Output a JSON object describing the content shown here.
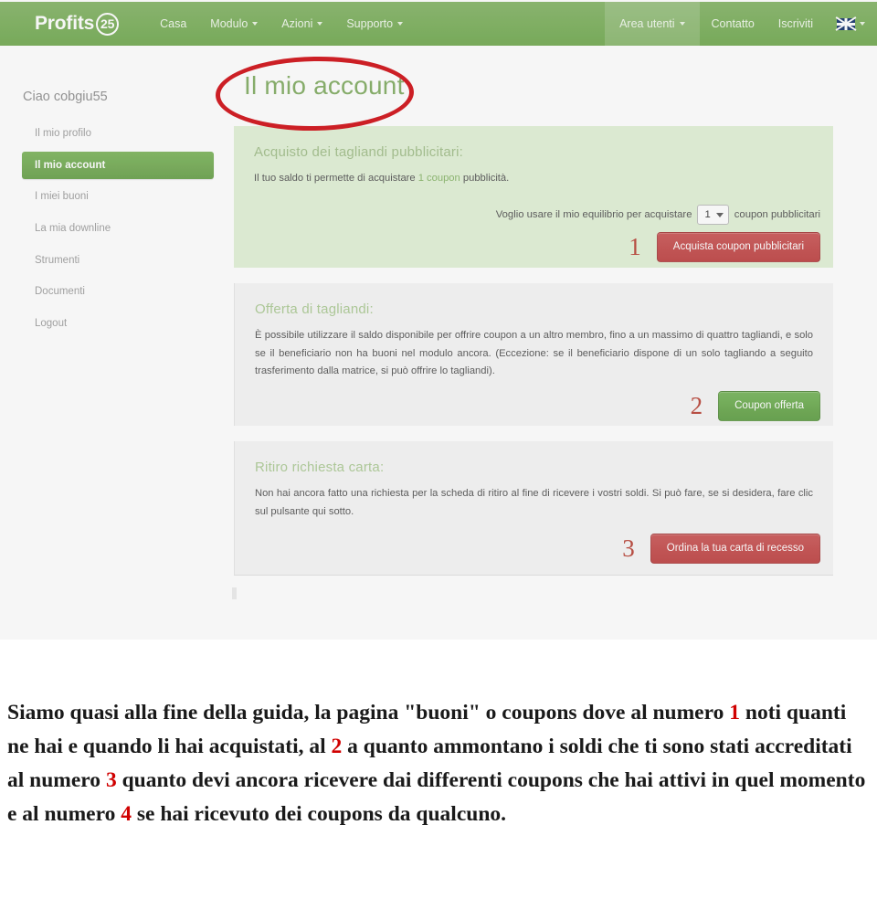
{
  "navbar": {
    "brand_text": "Profits",
    "brand_badge": "25",
    "left_items": [
      {
        "label": "Casa",
        "caret": false
      },
      {
        "label": "Modulo",
        "caret": true
      },
      {
        "label": "Azioni",
        "caret": true
      },
      {
        "label": "Supporto",
        "caret": true
      }
    ],
    "right_items": [
      {
        "label": "Area utenti",
        "caret": true,
        "active": true
      },
      {
        "label": "Contatto",
        "caret": false,
        "active": false
      },
      {
        "label": "Iscriviti",
        "caret": false,
        "active": false
      }
    ],
    "language_flag": "uk-flag-icon",
    "colors": {
      "bar": "#70ad47",
      "text": "#eef7e8"
    }
  },
  "sidebar": {
    "greeting": "Ciao cobgiu55",
    "items": [
      {
        "label": "Il mio profilo",
        "active": false
      },
      {
        "label": "Il mio account",
        "active": true
      },
      {
        "label": "I miei buoni",
        "active": false
      },
      {
        "label": "La mia downline",
        "active": false
      },
      {
        "label": "Strumenti",
        "active": false
      },
      {
        "label": "Documenti",
        "active": false
      },
      {
        "label": "Logout",
        "active": false
      }
    ],
    "active_color": "#69ab43"
  },
  "page": {
    "title": "Il mio account",
    "title_color": "#7aab56",
    "annotation_circle_color": "#cc1f25"
  },
  "panels": {
    "purchase": {
      "title": "Acquisto dei tagliandi pubblicitari:",
      "balance_text_before": "Il tuo saldo ti permette di acquistare ",
      "balance_highlight": "1 coupon",
      "balance_text_after": " pubblicità.",
      "buy_label_before": "Voglio usare il mio equilibrio per acquistare",
      "select_value": "1",
      "buy_label_after": "coupon pubblicitari",
      "step_number": "1",
      "button_label": "Acquista coupon pubblicitari",
      "button_color": "#cf4343",
      "background": "#dff0d2"
    },
    "offer": {
      "title": "Offerta di tagliandi:",
      "body": "È possibile utilizzare il saldo disponibile per offrire coupon a un altro membro, fino a un massimo di quattro tagliandi, e solo se il beneficiario non ha buoni nel modulo ancora. (Eccezione: se il beneficiario dispone di un solo tagliando a seguito trasferimento dalla matrice, si può offrire lo tagliandi).",
      "step_number": "2",
      "button_label": "Coupon offerta",
      "button_color": "#5fab3e",
      "background": "#f4f4f4"
    },
    "withdraw": {
      "title": "Ritiro richiesta carta:",
      "body": "Non hai ancora fatto una richiesta per la scheda di ritiro al fine di ricevere i vostri soldi. Si può fare, se si desidera, fare clic sul pulsante qui sotto.",
      "step_number": "3",
      "button_label": "Ordina la tua carta di recesso",
      "button_color": "#cf4343",
      "background": "#f4f4f4"
    }
  },
  "caption": {
    "seg_1": "Siamo quasi alla fine della guida, la pagina \"buoni\" o coupons dove al numero ",
    "num_1": "1",
    "seg_2": " noti quanti ne hai e quando li hai acquistati, al ",
    "num_2": "2",
    "seg_3": " a quanto ammontano i soldi che ti sono stati accreditati al numero ",
    "num_3": "3",
    "seg_4": " quanto devi ancora ricevere dai differenti coupons che hai attivi in quel momento e al numero ",
    "num_4": "4",
    "seg_5": " se hai ricevuto dei coupons da qualcuno.",
    "number_color": "#d00000"
  }
}
